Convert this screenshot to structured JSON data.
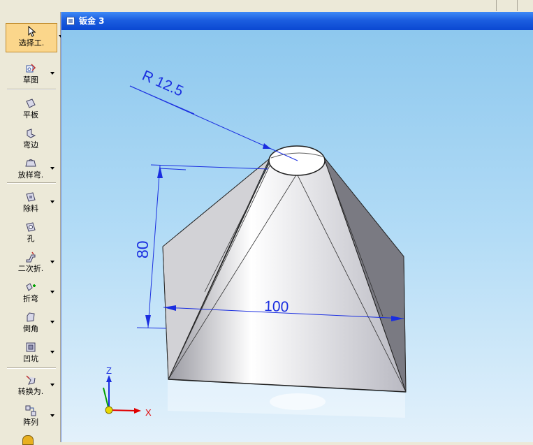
{
  "toolbar": {
    "items": [
      {
        "label": "选择工.",
        "icon": "select-arrow-icon",
        "dropdown": true,
        "active": true
      },
      {
        "label": "草图",
        "icon": "sketch-icon",
        "dropdown": true
      },
      {
        "label": "平板",
        "icon": "tab-plate-icon",
        "dropdown": false
      },
      {
        "label": "弯边",
        "icon": "flange-icon",
        "dropdown": false
      },
      {
        "label": "放样弯.",
        "icon": "lofted-flange-icon",
        "dropdown": true
      },
      {
        "label": "除料",
        "icon": "cutout-icon",
        "dropdown": true
      },
      {
        "label": "孔",
        "icon": "hole-icon",
        "dropdown": false
      },
      {
        "label": "二次折.",
        "icon": "jog-icon",
        "dropdown": true
      },
      {
        "label": "折弯",
        "icon": "bend-icon",
        "dropdown": true
      },
      {
        "label": "倒角",
        "icon": "chamfer-icon",
        "dropdown": true
      },
      {
        "label": "凹坑",
        "icon": "dimple-icon",
        "dropdown": true
      },
      {
        "label": "转换为.",
        "icon": "convert-icon",
        "dropdown": true
      },
      {
        "label": "阵列",
        "icon": "pattern-icon",
        "dropdown": true
      }
    ]
  },
  "window": {
    "title": "钣金 3"
  },
  "model": {
    "dimensions": {
      "radius": "R 12.5",
      "height": "80",
      "width": "100"
    },
    "triad": {
      "z": "Z",
      "x": "X"
    }
  },
  "colors": {
    "title_bar": "#0a48d2",
    "viewport_top": "#8ec8ee",
    "dimension": "#1a2ee0",
    "triad_x": "#e00000",
    "triad_z": "#1a2ee0",
    "triad_y": "#00a000"
  }
}
